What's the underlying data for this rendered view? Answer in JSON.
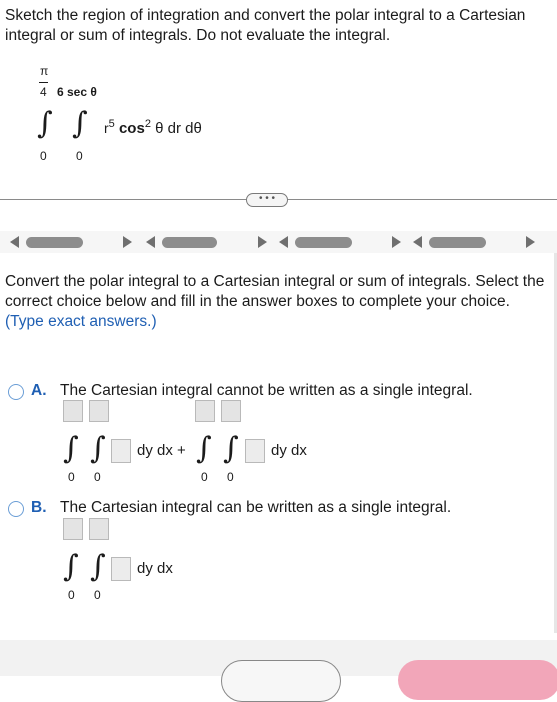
{
  "question": {
    "prompt": "Sketch the region of integration and convert the polar integral to a Cartesian integral or sum of integrals. Do not evaluate the integral.",
    "integral": {
      "outer_upper_num": "π",
      "outer_upper_den": "4",
      "inner_upper": "6 sec θ",
      "outer_lower": "0",
      "inner_lower": "0",
      "r_base": "r",
      "r_exp": "5",
      "cos": "cos",
      "cos_exp": "2",
      "tail": "θ dr dθ"
    }
  },
  "ellipsis": "• • •",
  "instructions": {
    "main": "Convert the polar integral to a Cartesian integral or sum of integrals. Select the correct choice below and fill in the answer boxes to complete your choice.",
    "hint": "(Type exact answers.)"
  },
  "options": {
    "a": {
      "letter": "A.",
      "text": "The Cartesian integral cannot be written as a single integral.",
      "lower1": "0",
      "lower2": "0",
      "lower3": "0",
      "lower4": "0",
      "dydx1": "dy dx +",
      "dydx2": "dy dx"
    },
    "b": {
      "letter": "B.",
      "text": "The Cartesian integral can be written as a single integral.",
      "lower1": "0",
      "lower2": "0",
      "dydx": "dy dx"
    }
  },
  "colors": {
    "accent_blue": "#1f5fb3",
    "radio_border": "#6b9ed6",
    "check_button": "#f2a6b9"
  }
}
